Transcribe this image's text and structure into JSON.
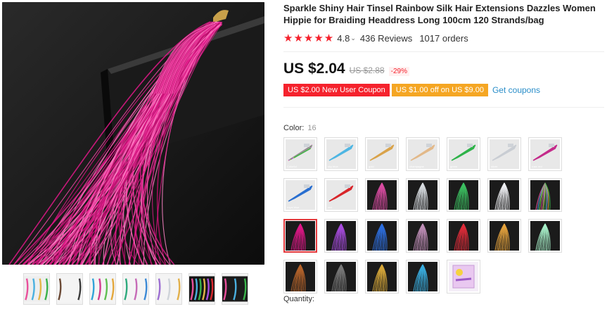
{
  "product": {
    "title": "Sparkle Shiny Hair Tinsel Rainbow Silk Hair Extensions Dazzles Women Hippie for Braiding Headdress Long 100cm 120 Strands/bag",
    "rating": {
      "stars": 5,
      "score": "4.8",
      "reviews": "436 Reviews",
      "orders": "1017 orders"
    },
    "price": {
      "current": "US $2.04",
      "original": "US $2.88",
      "discount": "-29%"
    },
    "coupons": [
      {
        "label": "US $2.00 New User Coupon",
        "color": "#f5222d"
      },
      {
        "label": "US $1.00 off on US $9.00",
        "color": "#f5a623"
      }
    ],
    "get_coupons_label": "Get coupons",
    "color_label": "Color:",
    "color_count": "16",
    "quantity_label": "Quantity:"
  },
  "swatches": [
    {
      "name": "Colorful",
      "color": "#b68fd1",
      "bg": "#e8e8e8",
      "multi": true
    },
    {
      "name": "sky blue",
      "color": "#4fb6e3",
      "bg": "#e8e8e8"
    },
    {
      "name": "gold",
      "color": "#d9a34b",
      "bg": "#e8e8e8"
    },
    {
      "name": "champagne",
      "color": "#e2b98a",
      "bg": "#e8e8e8"
    },
    {
      "name": "green",
      "color": "#2fb34a",
      "bg": "#e8e8e8"
    },
    {
      "name": "silver",
      "color": "#c9cdd3",
      "bg": "#e8e8e8"
    },
    {
      "name": "rose red",
      "color": "#c42c8b",
      "bg": "#e8e8e8"
    },
    {
      "name": "royal blue",
      "color": "#2a6fd0",
      "bg": "#e8e8e8"
    },
    {
      "name": "red",
      "color": "#d8262b",
      "bg": "#e8e8e8"
    },
    {
      "name": "",
      "color": "#d94ba2",
      "bg": "#1b1b1b"
    },
    {
      "name": "",
      "color": "#d7dbe0",
      "bg": "#1b1b1b"
    },
    {
      "name": "",
      "color": "#3cc060",
      "bg": "#1b1b1b"
    },
    {
      "name": "",
      "color": "#eef0f3",
      "bg": "#1b1b1b"
    },
    {
      "name": "",
      "color": "#c49bb0",
      "bg": "#1b1b1b",
      "multi": true
    },
    {
      "name": "",
      "color": "#e3178a",
      "bg": "#1b1b1b"
    },
    {
      "name": "",
      "color": "#a84de0",
      "bg": "#1b1b1b"
    },
    {
      "name": "",
      "color": "#2e6fe0",
      "bg": "#1b1b1b"
    },
    {
      "name": "",
      "color": "#c08fb8",
      "bg": "#1b1b1b"
    },
    {
      "name": "",
      "color": "#e02c3a",
      "bg": "#1b1b1b"
    },
    {
      "name": "",
      "color": "#e5a33d",
      "bg": "#1b1b1b"
    },
    {
      "name": "",
      "color": "#a7f0c9",
      "bg": "#1b1b1b"
    },
    {
      "name": "",
      "color": "#b8652b",
      "bg": "#1b1b1b"
    },
    {
      "name": "",
      "color": "#7a7a7a",
      "bg": "#1b1b1b"
    },
    {
      "name": "",
      "color": "#d8a83a",
      "bg": "#1b1b1b"
    },
    {
      "name": "",
      "color": "#3aaee0",
      "bg": "#1b1b1b"
    },
    {
      "name": "",
      "color": "#e9d4f0",
      "bg": "#f4eef7",
      "package": true
    }
  ],
  "selected_swatch": 14,
  "thumbnails": [
    {
      "name": "thumb-1",
      "colors": [
        "#e94f9b",
        "#4ab0e0",
        "#e4b548",
        "#39b24a"
      ],
      "bg": "#eeeeee"
    },
    {
      "name": "thumb-2",
      "colors": [
        "#6b4a36",
        "#3a3a3a"
      ],
      "bg": "#f4f4f4"
    },
    {
      "name": "thumb-3",
      "colors": [
        "#31a3d8",
        "#d33b8e",
        "#5fbf52",
        "#e4a83d"
      ],
      "bg": "#f4f4f4"
    },
    {
      "name": "thumb-4",
      "colors": [
        "#2eaa7d",
        "#c66bb7",
        "#3c8ad6"
      ],
      "bg": "#f4f4f4"
    },
    {
      "name": "thumb-5",
      "colors": [
        "#9d6fd2",
        "#cfd4da",
        "#e2b04a"
      ],
      "bg": "#f4f4f4"
    },
    {
      "name": "thumb-6",
      "colors": [
        "#e94f9b",
        "#4ab0e0",
        "#39b24a",
        "#e4b548",
        "#a84de0",
        "#d8262b"
      ],
      "bg": "#151515"
    },
    {
      "name": "thumb-7",
      "colors": [
        "#e94f9b",
        "#4ab0e0",
        "#39b24a"
      ],
      "bg": "#1b1b1b"
    }
  ]
}
